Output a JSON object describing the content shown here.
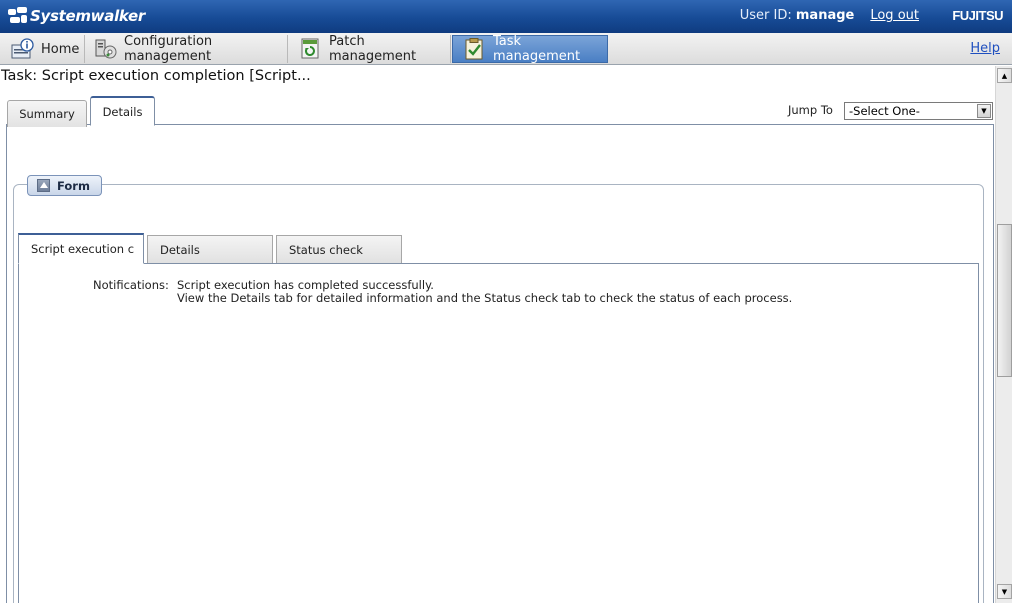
{
  "header": {
    "brand": "Systemwalker",
    "user_label": "User ID:",
    "user_id": "manage",
    "logout": "Log out",
    "vendor": "FUJITSU"
  },
  "nav": {
    "items": [
      {
        "label": "Home",
        "icon": "home-info-icon"
      },
      {
        "label": "Configuration management",
        "icon": "configuration-icon"
      },
      {
        "label": "Patch management",
        "icon": "patch-icon"
      },
      {
        "label": "Task management",
        "icon": "task-checklist-icon",
        "active": true
      }
    ],
    "help": "Help"
  },
  "page": {
    "title": "Task: Script execution completion [Script..."
  },
  "outer_tabs": [
    {
      "label": "Summary",
      "active": false
    },
    {
      "label": "Details",
      "active": true
    }
  ],
  "jump_to": {
    "label": "Jump To",
    "selected": "-Select One-"
  },
  "form": {
    "legend": "Form",
    "tabs": [
      {
        "label": "Script execution c",
        "active": true
      },
      {
        "label": "Details",
        "active": false
      },
      {
        "label": "Status check",
        "active": false
      }
    ],
    "notifications_label": "Notifications:",
    "notifications_lines": [
      "Script execution has completed successfully.",
      "View the Details tab for detailed information and the Status check tab to check the status of each process."
    ]
  },
  "colors": {
    "header_blue": "#174b96",
    "active_nav": "#4a7fc4",
    "link_blue": "#1f4fbf"
  }
}
